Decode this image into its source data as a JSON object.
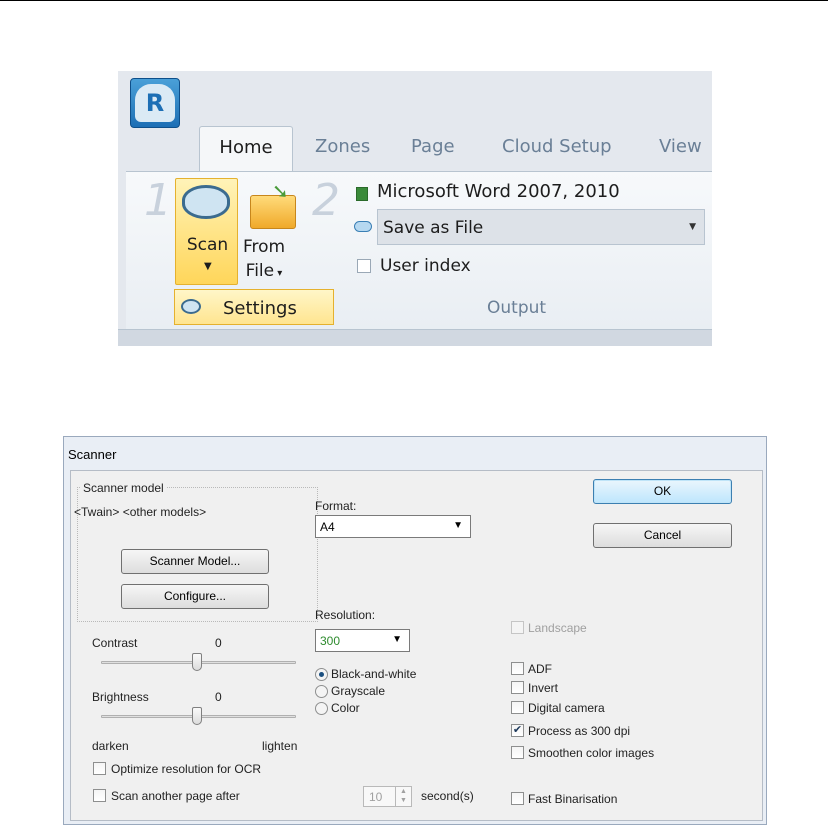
{
  "ribbon": {
    "app_logo_letter": "R",
    "tabs": [
      "Home",
      "Zones",
      "Page",
      "Cloud Setup",
      "View"
    ],
    "step1": "1",
    "step2": "2",
    "scan_label": "Scan",
    "from_file_line1": "From",
    "from_file_line2": "File",
    "output_format": "Microsoft Word 2007, 2010",
    "save_target": "Save as File",
    "user_index": "User index",
    "group_output": "Output",
    "settings_menu": "Settings"
  },
  "dialog": {
    "title": "Scanner",
    "scanner_model_group": "Scanner model",
    "scanner_model_value": "<Twain> <other models>",
    "scanner_model_button": "Scanner Model...",
    "configure_button": "Configure...",
    "format_label": "Format:",
    "format_value": "A4",
    "resolution_label": "Resolution:",
    "resolution_value": "300",
    "resolution_color": "#2e8b2e",
    "contrast_label": "Contrast",
    "contrast_value": "0",
    "brightness_label": "Brightness",
    "brightness_value": "0",
    "darken": "darken",
    "lighten": "lighten",
    "color_modes": [
      "Black-and-white",
      "Grayscale",
      "Color"
    ],
    "selected_color_mode": "Black-and-white",
    "ok_button": "OK",
    "cancel_button": "Cancel",
    "landscape": "Landscape",
    "adf": "ADF",
    "invert": "Invert",
    "digital_camera": "Digital camera",
    "process_300": "Process as 300 dpi",
    "smoothen": "Smoothen color images",
    "optimize_ocr": "Optimize resolution for OCR",
    "scan_another": "Scan another page after",
    "seconds_value": "10",
    "seconds_unit": "second(s)",
    "fast_binarisation": "Fast Binarisation",
    "checked": {
      "landscape": false,
      "adf": false,
      "invert": false,
      "digital_camera": false,
      "process_300": true,
      "smoothen": false,
      "optimize_ocr": false,
      "scan_another": false,
      "fast_binarisation": false,
      "user_index": false
    }
  }
}
